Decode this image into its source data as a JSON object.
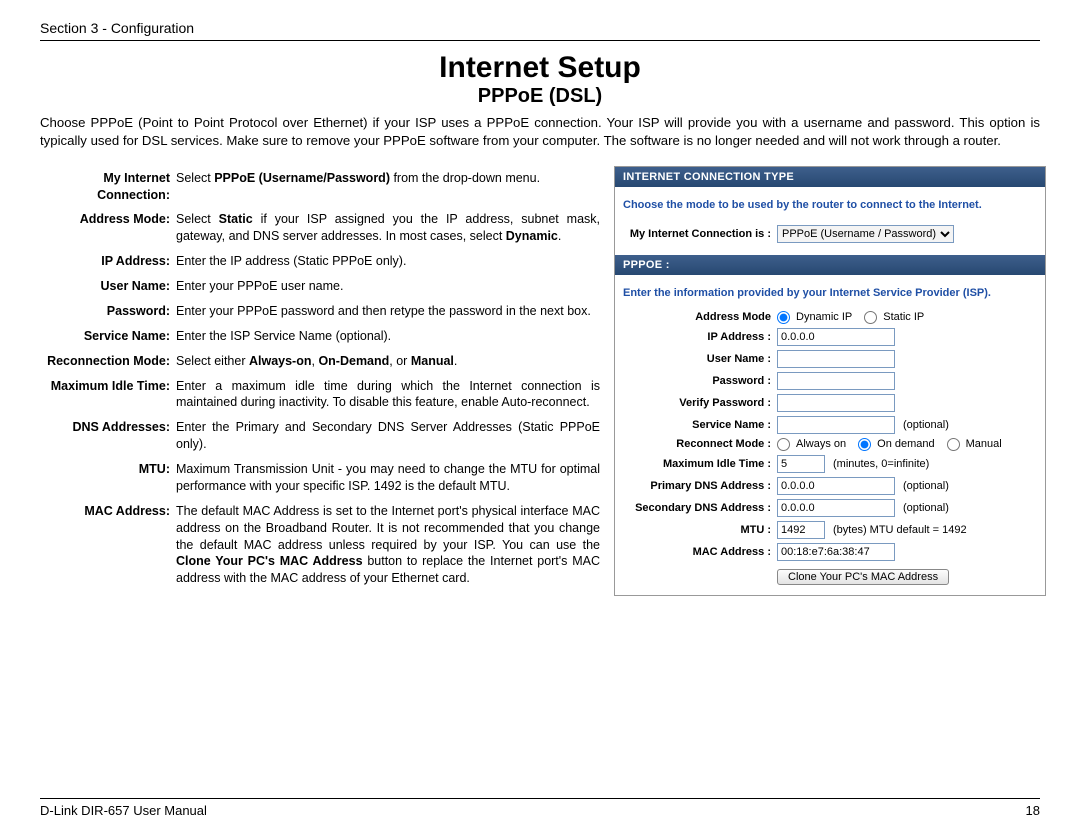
{
  "header": {
    "section": "Section 3 - Configuration"
  },
  "title": "Internet Setup",
  "subtitle": "PPPoE (DSL)",
  "intro": "Choose PPPoE (Point to Point Protocol over Ethernet) if your ISP uses a PPPoE connection. Your ISP will provide you with a username and password. This option is typically used for DSL services. Make sure to remove your PPPoE software from your computer. The software is no longer needed and will not work through a router.",
  "defs": {
    "my_internet_term": "My Internet Connection:",
    "my_internet_desc_prefix": "Select ",
    "my_internet_bold": "PPPoE (Username/Password)",
    "my_internet_desc_suffix": " from the drop-down menu.",
    "address_mode_term": "Address Mode:",
    "address_mode_prefix": "Select ",
    "address_mode_static": "Static",
    "address_mode_mid": " if your ISP assigned you the IP address, subnet mask, gateway, and DNS server addresses. In most cases, select ",
    "address_mode_dynamic": "Dynamic",
    "address_mode_suffix": ".",
    "ip_term": "IP Address:",
    "ip_desc": "Enter the IP address (Static PPPoE only).",
    "user_term": "User Name:",
    "user_desc": "Enter your PPPoE user name.",
    "pass_term": "Password:",
    "pass_desc": "Enter your PPPoE password and then retype the password in the next box.",
    "service_term": "Service Name:",
    "service_desc": "Enter the ISP Service Name (optional).",
    "reconn_term": "Reconnection Mode:",
    "reconn_prefix": "Select either ",
    "reconn_a": "Always-on",
    "reconn_sep1": ", ",
    "reconn_b": "On-Demand",
    "reconn_sep2": ", or ",
    "reconn_c": "Manual",
    "reconn_suffix": ".",
    "idle_term": "Maximum Idle Time:",
    "idle_desc": "Enter a maximum idle time during which the Internet connection is maintained during inactivity. To disable this feature, enable Auto-reconnect.",
    "dns_term": "DNS Addresses:",
    "dns_desc": "Enter the Primary and Secondary DNS Server Addresses (Static PPPoE only).",
    "mtu_term": "MTU:",
    "mtu_desc": "Maximum Transmission Unit - you may need to change the MTU for optimal performance with your specific ISP. 1492 is the default MTU.",
    "mac_term": "MAC Address:",
    "mac_prefix": "The default MAC Address is set to the Internet port's physical interface MAC address on the Broadband Router. It is not recommended that you change the default MAC address unless required by your ISP. You can use the ",
    "mac_bold": "Clone Your PC's MAC Address",
    "mac_suffix": " button to replace the Internet port's MAC address with the MAC address of your Ethernet card."
  },
  "router": {
    "bar1": "Internet Connection Type",
    "choose": "Choose the mode to be used by the router to connect to the Internet.",
    "mic_label": "My Internet Connection is :",
    "mic_value": "PPPoE (Username / Password)",
    "bar2": "PPPOE :",
    "info": "Enter the information provided by your Internet Service Provider (ISP).",
    "addr_mode_label": "Address Mode",
    "addr_dyn": "Dynamic IP",
    "addr_stat": "Static IP",
    "ip_label": "IP Address :",
    "ip_value": "0.0.0.0",
    "user_label": "User Name :",
    "user_value": "",
    "pass_label": "Password :",
    "pass_value": "",
    "verify_label": "Verify Password :",
    "verify_value": "",
    "service_label": "Service Name :",
    "service_value": "",
    "optional": "(optional)",
    "reconn_label": "Reconnect Mode :",
    "reconn_always": "Always on",
    "reconn_ondemand": "On demand",
    "reconn_manual": "Manual",
    "idle_label": "Maximum Idle Time :",
    "idle_value": "5",
    "idle_units": "(minutes, 0=infinite)",
    "pdns_label": "Primary DNS Address :",
    "pdns_value": "0.0.0.0",
    "sdns_label": "Secondary DNS Address :",
    "sdns_value": "0.0.0.0",
    "mtu_label": "MTU :",
    "mtu_value": "1492",
    "mtu_units": "(bytes) MTU default = 1492",
    "mac_label": "MAC Address :",
    "mac_value": "00:18:e7:6a:38:47",
    "clone_btn": "Clone Your PC's MAC Address"
  },
  "footer": {
    "manual": "D-Link DIR-657 User Manual",
    "page": "18"
  }
}
